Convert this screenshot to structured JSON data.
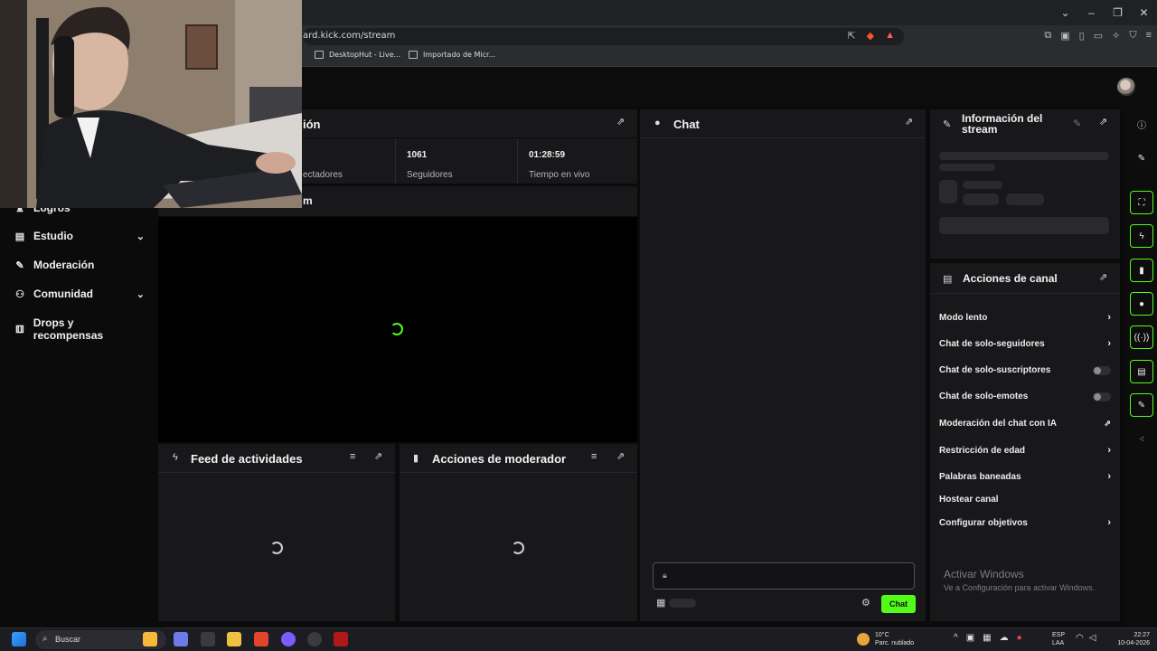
{
  "browser": {
    "url": "ard.kick.com/stream",
    "bookmarks": [
      "DesktopHut - Live...",
      "Importado de Micr..."
    ]
  },
  "nav": {
    "items": [
      {
        "label": "Logros",
        "icon": "trophy-icon"
      },
      {
        "label": "Estudio",
        "icon": "studio-icon",
        "expandable": true
      },
      {
        "label": "Moderación",
        "icon": "wrench-icon"
      },
      {
        "label": "Comunidad",
        "icon": "people-icon",
        "expandable": true
      },
      {
        "label": "Drops y recompensas",
        "icon": "gift-icon"
      }
    ]
  },
  "session": {
    "title_partial": "ión",
    "stats": [
      {
        "value": "",
        "label": "ectadores"
      },
      {
        "value": "1061",
        "label": "Seguidores"
      },
      {
        "value": "01:28:59",
        "label": "Tiempo en vivo"
      }
    ],
    "stream_title_partial": "m"
  },
  "panels": {
    "activity": {
      "title": "Feed de actividades"
    },
    "mod_actions": {
      "title": "Acciones de moderador"
    },
    "chat": {
      "title": "Chat",
      "send_label": "Chat"
    },
    "stream_info": {
      "title": "Información del stream"
    },
    "channel_actions": {
      "title": "Acciones de canal",
      "items": [
        {
          "label": "Modo lento",
          "control": "chevron"
        },
        {
          "label": "Chat de solo-seguidores",
          "control": "chevron"
        },
        {
          "label": "Chat de solo-suscriptores",
          "control": "toggle",
          "on": false
        },
        {
          "label": "Chat de solo-emotes",
          "control": "toggle",
          "on": false
        },
        {
          "label": "Moderación del chat con IA",
          "control": "external"
        },
        {
          "label": "Restricción de edad",
          "control": "chevron"
        },
        {
          "label": "Palabras baneadas",
          "control": "chevron"
        },
        {
          "label": "Hostear canal",
          "control": "none"
        },
        {
          "label": "Configurar objetivos",
          "control": "chevron"
        }
      ]
    }
  },
  "watermark": {
    "title": "Activar Windows",
    "subtitle": "Ve a Configuración para activar Windows."
  },
  "taskbar": {
    "search": "Buscar",
    "weather_temp": "10°C",
    "weather_desc": "Parc. nublado",
    "lang_top": "ESP",
    "lang_bottom": "LAA",
    "time": "22:27",
    "date": "10-04-2026"
  },
  "colors": {
    "accent": "#53fc18",
    "panel": "#18181b",
    "background": "#0b0b0c"
  }
}
